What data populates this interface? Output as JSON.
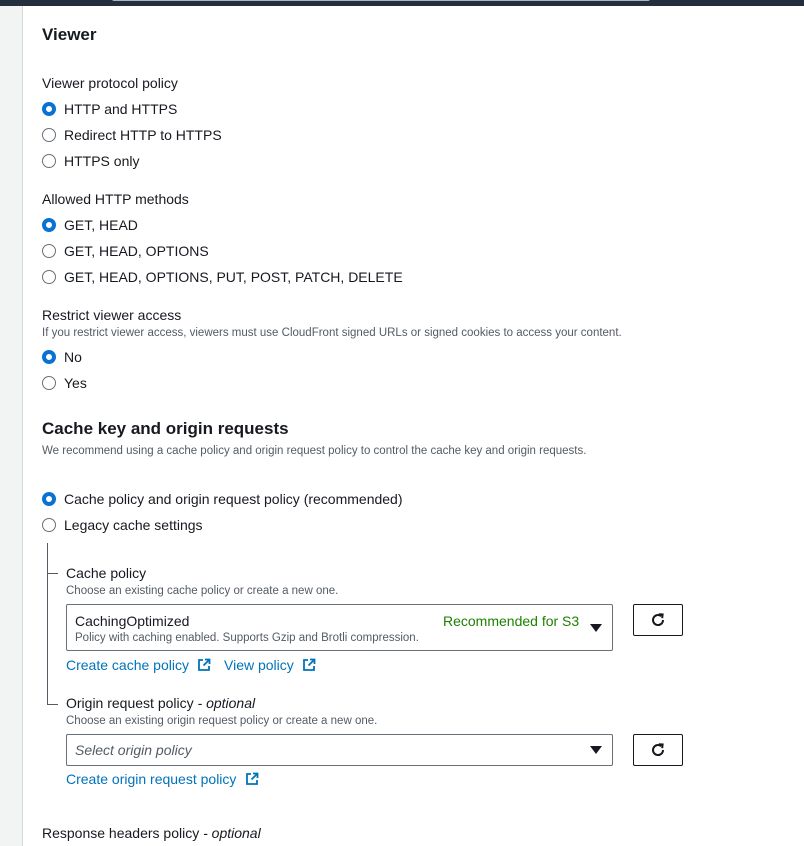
{
  "viewer": {
    "title": "Viewer",
    "protocol": {
      "label": "Viewer protocol policy",
      "options": [
        "HTTP and HTTPS",
        "Redirect HTTP to HTTPS",
        "HTTPS only"
      ],
      "selected": "HTTP and HTTPS"
    },
    "methods": {
      "label": "Allowed HTTP methods",
      "options": [
        "GET, HEAD",
        "GET, HEAD, OPTIONS",
        "GET, HEAD, OPTIONS, PUT, POST, PATCH, DELETE"
      ],
      "selected": "GET, HEAD"
    },
    "restrict": {
      "label": "Restrict viewer access",
      "description": "If you restrict viewer access, viewers must use CloudFront signed URLs or signed cookies to access your content.",
      "options": [
        "No",
        "Yes"
      ],
      "selected": "No"
    }
  },
  "cache": {
    "title": "Cache key and origin requests",
    "description": "We recommend using a cache policy and origin request policy to control the cache key and origin requests.",
    "options": [
      "Cache policy and origin request policy (recommended)",
      "Legacy cache settings"
    ],
    "selected": "Cache policy and origin request policy (recommended)",
    "cache_policy": {
      "label": "Cache policy",
      "description": "Choose an existing cache policy or create a new one.",
      "value": "CachingOptimized",
      "value_description": "Policy with caching enabled. Supports Gzip and Brotli compression.",
      "badge": "Recommended for S3",
      "create_link": "Create cache policy",
      "view_link": "View policy"
    },
    "origin_policy": {
      "label": "Origin request policy",
      "optional": "- optional",
      "description": "Choose an existing origin request policy or create a new one.",
      "placeholder": "Select origin policy",
      "create_link": "Create origin request policy"
    }
  },
  "response_headers": {
    "label": "Response headers policy",
    "optional": "- optional"
  },
  "colors": {
    "accent": "#0972d3",
    "link": "#0073bb",
    "success": "#1d8102"
  }
}
